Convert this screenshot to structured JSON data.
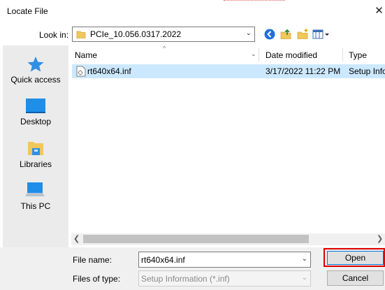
{
  "window": {
    "title": "Locate File",
    "close_glyph": "✕"
  },
  "look_in": {
    "label": "Look in:",
    "value": "PCIe_10.056.0317.2022"
  },
  "toolbar": {
    "icons": [
      "back-icon",
      "up-folder-icon",
      "new-folder-icon",
      "view-menu-icon"
    ]
  },
  "places": [
    {
      "label": "Quick access",
      "icon": "star-icon"
    },
    {
      "label": "Desktop",
      "icon": "desktop-icon"
    },
    {
      "label": "Libraries",
      "icon": "libraries-icon"
    },
    {
      "label": "This PC",
      "icon": "computer-icon"
    }
  ],
  "file_list": {
    "columns": [
      "Name",
      "Date modified",
      "Type"
    ],
    "rows": [
      {
        "name": "rt640x64.inf",
        "date_modified": "3/17/2022 11:22 PM",
        "type": "Setup Information"
      }
    ],
    "selected_row": 0
  },
  "file_name": {
    "label": "File name:",
    "value": "rt640x64.inf"
  },
  "files_of_type": {
    "label": "Files of type:",
    "value": "Setup Information (*.inf)"
  },
  "buttons": {
    "open": "Open",
    "cancel": "Cancel"
  },
  "colors": {
    "selection": "#cce8ff",
    "highlight_box": "#e00000",
    "default_button_border": "#0078d7",
    "places_bg": "#ebebeb"
  }
}
